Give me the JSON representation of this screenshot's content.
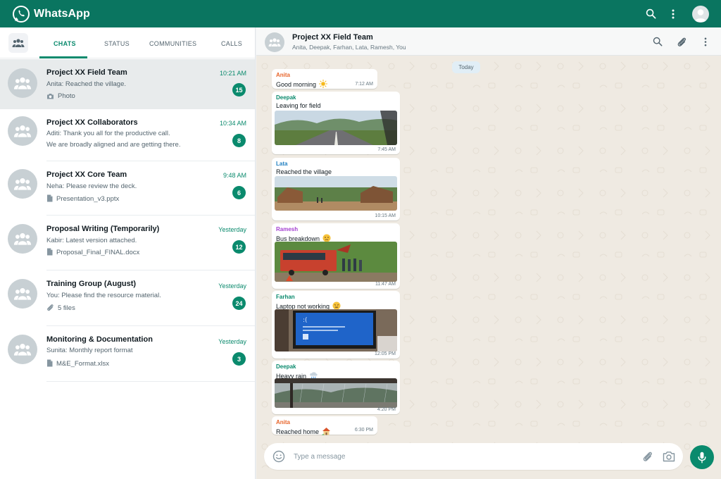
{
  "app": {
    "title": "WhatsApp"
  },
  "colors": {
    "brand": "#0a7560",
    "accent": "#0a8a6d",
    "chat_bg": "#efeae2"
  },
  "tabs": [
    {
      "label": "CHATS",
      "active": true
    },
    {
      "label": "STATUS",
      "active": false
    },
    {
      "label": "COMMUNITIES",
      "active": false
    },
    {
      "label": "CALLS",
      "active": false
    }
  ],
  "chats": [
    {
      "title": "Project XX Field Team",
      "time": "10:21 AM",
      "line1": "Anita: Reached the village.",
      "line2": "Photo",
      "line2_icon": "camera-icon",
      "unread": "15",
      "selected": true
    },
    {
      "title": "Project XX Collaborators",
      "time": "10:34 AM",
      "line1": "Aditi: Thank you all for the productive call.",
      "line2": "We are broadly aligned and are getting there.",
      "line2_icon": "",
      "unread": "8",
      "selected": false
    },
    {
      "title": "Project XX Core Team",
      "time": "9:48 AM",
      "line1": "Neha: Please review the deck.",
      "line2": "Presentation_v3.pptx",
      "line2_icon": "document-icon",
      "unread": "6",
      "selected": false
    },
    {
      "title": "Proposal Writing (Temporarily)",
      "time": "Yesterday",
      "line1": "Kabir: Latest version attached.",
      "line2": "Proposal_Final_FINAL.docx",
      "line2_icon": "document-icon",
      "unread": "12",
      "selected": false
    },
    {
      "title": "Training Group (August)",
      "time": "Yesterday",
      "line1": "You: Please find the resource material.",
      "line2": "5 files",
      "line2_icon": "paperclip-icon",
      "unread": "24",
      "selected": false
    },
    {
      "title": "Monitoring & Documentation",
      "time": "Yesterday",
      "line1": "Sunita: Monthly report format",
      "line2": "M&E_Format.xlsx",
      "line2_icon": "document-icon",
      "unread": "3",
      "selected": false
    }
  ],
  "conversation": {
    "title": "Project XX Field Team",
    "members": "Anita, Deepak, Farhan, Lata, Ramesh, You",
    "date_label": "Today",
    "messages": [
      {
        "sender": "Anita",
        "sender_color": "#e8652b",
        "text": "Good morning",
        "emoji": "sun-emoji",
        "time": "7:12 AM",
        "photo": ""
      },
      {
        "sender": "Deepak",
        "sender_color": "#0a8a6d",
        "text": "Leaving for field",
        "emoji": "",
        "time": "7:45 AM",
        "photo": "road-photo"
      },
      {
        "sender": "Lata",
        "sender_color": "#1f7fc1",
        "text": "Reached the village",
        "emoji": "",
        "time": "10:15 AM",
        "photo": "village-photo"
      },
      {
        "sender": "Ramesh",
        "sender_color": "#a43fd1",
        "text": "Bus breakdown",
        "emoji": "frowning-emoji",
        "time": "11:47 AM",
        "photo": "bus-photo"
      },
      {
        "sender": "Farhan",
        "sender_color": "#0a8a6d",
        "text": "Laptop not working",
        "emoji": "confounded-emoji",
        "time": "12:05 PM",
        "photo": "laptop-photo"
      },
      {
        "sender": "Deepak",
        "sender_color": "#0a8a6d",
        "text": "Heavy rain",
        "emoji": "rain-cloud-emoji",
        "time": "4:20 PM",
        "photo": "rain-photo"
      },
      {
        "sender": "Anita",
        "sender_color": "#e8652b",
        "text": "Reached home",
        "emoji": "house-emoji",
        "time": "6:30 PM",
        "photo": ""
      }
    ]
  },
  "composer": {
    "placeholder": "Type a message"
  }
}
